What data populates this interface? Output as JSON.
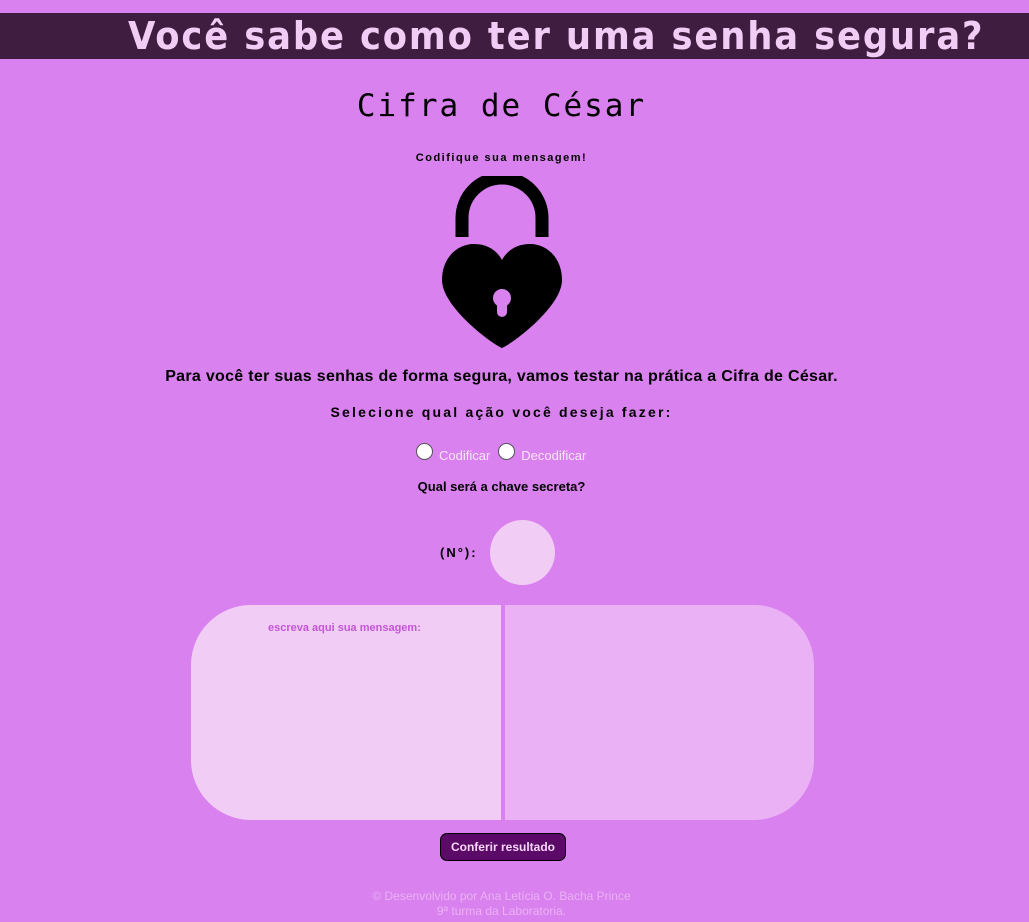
{
  "header": {
    "title": "Você sabe como ter uma senha segura?"
  },
  "section": {
    "subtitle": "Cifra de César",
    "encode_label": "Codifique sua mensagem!",
    "lock_icon": "heart-padlock-icon",
    "intro": "Para você ter suas senhas de forma segura, vamos testar na prática a Cifra de César.",
    "select_label": "Selecione qual ação você deseja fazer:"
  },
  "options": {
    "encode": "Codificar",
    "decode": "Decodificar"
  },
  "key": {
    "question": "Qual será a chave secreta?",
    "label": "(N°):"
  },
  "message": {
    "placeholder": "escreva aqui sua mensagem:"
  },
  "actions": {
    "check": "Conferir resultado"
  },
  "footer": {
    "line1": "© Desenvolvido por Ana Letícia O. Bacha Prince",
    "line2": "9ª turma da Laboratoria."
  },
  "colors": {
    "background": "#d981ee",
    "header_bg": "#3f1d40",
    "header_text": "#f1cdf5",
    "button_bg": "#5b0a67"
  }
}
